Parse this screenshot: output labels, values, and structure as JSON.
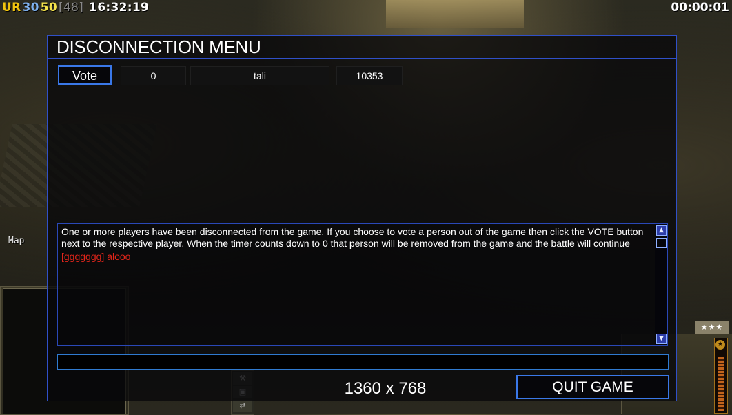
{
  "hud": {
    "faction": "UR",
    "value_a": "30",
    "value_b": "50",
    "value_c": "[48]",
    "clock": "16:32:19",
    "game_timer": "00:00:01"
  },
  "sidebar": {
    "map_label": "Map",
    "rank_stars": "★★★"
  },
  "dialog": {
    "title": "DISCONNECTION MENU",
    "players": [
      {
        "vote_label": "Vote",
        "count": "0",
        "name": "tali",
        "ping": "10353"
      }
    ],
    "log": {
      "message": "One or more players have been disconnected from the game. If you choose to vote a person out of the game then click the VOTE button next to the respective player. When the timer counts down to 0 that person will be removed from the game and the battle will continue",
      "chat_sender": "[ggggggg]",
      "chat_text": "alooo"
    },
    "chat_input_value": "",
    "resolution": "1360 x 768",
    "quit_label": "QUIT GAME"
  },
  "colors": {
    "accent": "#3a78e8",
    "chat_red": "#e3251a",
    "hud_yellow": "#f5e34b",
    "hud_blue": "#7fb2f0"
  }
}
